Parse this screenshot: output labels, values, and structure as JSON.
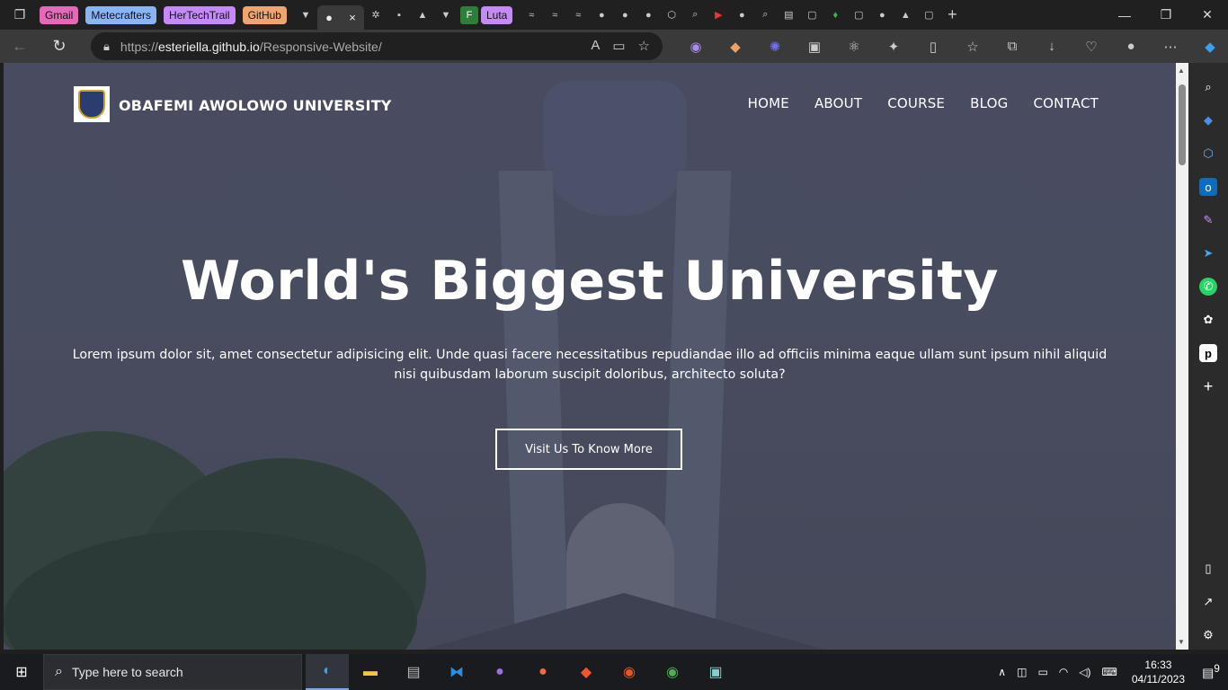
{
  "browser": {
    "tab_groups": [
      {
        "label": "Gmail",
        "color": "#e46ab9"
      },
      {
        "label": "Metecrafters",
        "color": "#8ab4f8"
      },
      {
        "label": "HerTechTrail",
        "color": "#c58af9"
      },
      {
        "label": "GitHub",
        "color": "#f0a56e"
      },
      {
        "label": "Luta",
        "color": "#c58af9"
      }
    ],
    "active_tab_close": "×",
    "new_tab": "+",
    "window_controls": {
      "minimize": "—",
      "maximize": "❐",
      "close": "✕"
    },
    "url_scheme": "https://",
    "url_host": "esteriella.github.io",
    "url_path": "/Responsive-Website/"
  },
  "page": {
    "brand": "OBAFEMI AWOLOWO UNIVERSITY",
    "nav": [
      "HOME",
      "ABOUT",
      "COURSE",
      "BLOG",
      "CONTACT"
    ],
    "hero_title": "World's Biggest University",
    "hero_text": "Lorem ipsum dolor sit, amet consectetur adipisicing elit. Unde quasi facere necessitatibus repudiandae illo ad officiis minima eaque ullam sunt ipsum nihil aliquid nisi quibusdam laborum suscipit doloribus, architecto soluta?",
    "hero_button": "Visit Us To Know More"
  },
  "taskbar": {
    "search_placeholder": "Type here to search",
    "time": "16:33",
    "date": "04/11/2023",
    "notification_count": "9"
  }
}
